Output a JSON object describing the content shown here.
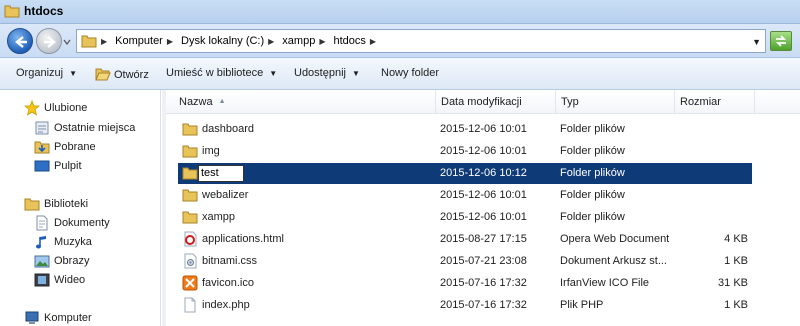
{
  "window": {
    "title": "htdocs"
  },
  "address": {
    "crumbs": [
      "Komputer",
      "Dysk lokalny (C:)",
      "xampp",
      "htdocs"
    ]
  },
  "toolbar": {
    "organize": "Organizuj",
    "open": "Otwórz",
    "include_library": "Umieść w bibliotece",
    "share": "Udostępnij",
    "new_folder": "Nowy folder"
  },
  "navpane": {
    "favorites": {
      "header": "Ulubione",
      "items": [
        "Ostatnie miejsca",
        "Pobrane",
        "Pulpit"
      ]
    },
    "libraries": {
      "header": "Biblioteki",
      "items": [
        "Dokumenty",
        "Muzyka",
        "Obrazy",
        "Wideo"
      ]
    },
    "computer": "Komputer"
  },
  "columns": {
    "name": "Nazwa",
    "modified": "Data modyfikacji",
    "type": "Typ",
    "size": "Rozmiar"
  },
  "files": [
    {
      "name": "dashboard",
      "modified": "2015-12-06 10:01",
      "type": "Folder plików",
      "size": "",
      "icon": "folder-icon"
    },
    {
      "name": "img",
      "modified": "2015-12-06 10:01",
      "type": "Folder plików",
      "size": "",
      "icon": "folder-icon"
    },
    {
      "name": "test",
      "modified": "2015-12-06 10:12",
      "type": "Folder plików",
      "size": "",
      "icon": "folder-icon",
      "selected": true,
      "renaming": true
    },
    {
      "name": "webalizer",
      "modified": "2015-12-06 10:01",
      "type": "Folder plików",
      "size": "",
      "icon": "folder-icon"
    },
    {
      "name": "xampp",
      "modified": "2015-12-06 10:01",
      "type": "Folder plików",
      "size": "",
      "icon": "folder-icon"
    },
    {
      "name": "applications.html",
      "modified": "2015-08-27 17:15",
      "type": "Opera Web Document",
      "size": "4 KB",
      "icon": "opera-icon"
    },
    {
      "name": "bitnami.css",
      "modified": "2015-07-21 23:08",
      "type": "Dokument Arkusz st...",
      "size": "1 KB",
      "icon": "css-file-icon"
    },
    {
      "name": "favicon.ico",
      "modified": "2015-07-16 17:32",
      "type": "IrfanView ICO File",
      "size": "31 KB",
      "icon": "ico-file-icon"
    },
    {
      "name": "index.php",
      "modified": "2015-07-16 17:32",
      "type": "Plik PHP",
      "size": "1 KB",
      "icon": "file-icon"
    }
  ],
  "colors": {
    "selection": "#0f3a78",
    "titlebar": "#c9def5",
    "folder": "#e8c35a"
  }
}
